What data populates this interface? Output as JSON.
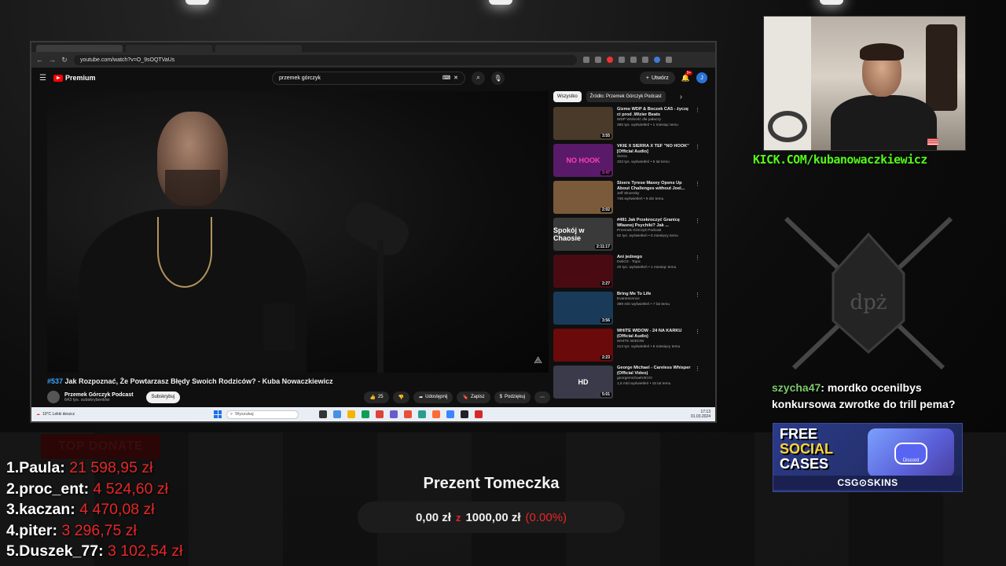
{
  "browser": {
    "url": "youtube.com/watch?v=O_9sOQTVaUs",
    "tabs": [
      "",
      "",
      ""
    ]
  },
  "youtube": {
    "logo_text": "Premium",
    "search_query": "przemek górczyk",
    "create_label": "Utwórz",
    "notif_count": "9+",
    "avatar_letter": "J",
    "video_title_hash": "#537",
    "video_title": "Jak Rozpoznać, Że Powtarzasz Błędy Swoich Rodziców? - Kuba Nowaczkiewicz",
    "channel_name": "Przemek Górczyk Podcast",
    "channel_subs": "643 tys. subskrybentów",
    "subscribe_label": "Subskrybuj",
    "like_count": "25",
    "share_label": "Udostępnij",
    "save_label": "Zapisz",
    "thanks_label": "Podziękuj",
    "chips": [
      "Wszystko",
      "Źródło: Przemek Górczyk Podcast"
    ],
    "recommendations": [
      {
        "title": "Gizmo WDP & Boczek CA5 - życzę ci      prod .Wizier Beats",
        "channel": "WDP Wolność dla pałaczy",
        "meta": "355 tys. wyświetleń • 1 miesiąc temu",
        "duration": "3:55",
        "thumb_color": "#4a3a2a"
      },
      {
        "title": "VKIE X SIERRA X TEF \"NO HOOK\" [Official Audio]",
        "channel": "Sierra",
        "meta": "333 tys. wyświetleń • 5 lat temu",
        "duration": "3:47",
        "thumb_color": "#5a1a6a",
        "thumb_text": "NO HOOK"
      },
      {
        "title": "Sixers Tyrese Maxey Opens Up About Challenges without Joel...",
        "channel": "Jeff Skversky",
        "meta": "746 wyświetleń • 9 dni temu",
        "duration": "2:02",
        "thumb_color": "#7a5a3a"
      },
      {
        "title": "#491 Jak Przekroczyć Granicę Własnej Psychiki? Jak ...",
        "channel": "Przemek Górczyk Podcast",
        "meta": "62 tys. wyświetleń • 5 miesięcy temu",
        "duration": "2:11:17",
        "thumb_color": "#3a3a3a",
        "thumb_text": "Spokój w Chaosie"
      },
      {
        "title": "Ani jednego",
        "channel": "DeliO3 - Topic",
        "meta": "20 tys. wyświetleń • 1 miesiąc temu",
        "duration": "2:27",
        "thumb_color": "#4a0a12"
      },
      {
        "title": "Bring Me To Life",
        "channel": "Evanescence",
        "meta": "389 mln wyświetleń • 7 lat temu",
        "duration": "3:56",
        "thumb_color": "#1a3a5a"
      },
      {
        "title": "WHITE WIDOW - 24 NA KARKU (Official Audio)",
        "channel": "WHITE WIDOW",
        "meta": "213 tys. wyświetleń • 8 miesięcy temu",
        "duration": "2:23",
        "thumb_color": "#6a0a0a"
      },
      {
        "title": "George Michael - Careless Whisper (Official Video)",
        "channel": "georgemichaelVEVO",
        "meta": "1,5 mld wyświetleń • 15 lat temu",
        "duration": "5:01",
        "thumb_color": "#3a3a4a",
        "thumb_text": "HD"
      }
    ]
  },
  "taskbar": {
    "weather": "10°C Lekki deszcz",
    "search_placeholder": "Wyszukaj",
    "time": "17:13",
    "date": "01.03.2024"
  },
  "overlay": {
    "kick_url": "KICK.COM/kubanowaczkiewicz",
    "chat_user": "szycha47",
    "chat_text": ": mordko ocenilbys konkursowa zwrotke do trill pema?",
    "promo_line1": "FREE",
    "promo_line2": "SOCIAL",
    "promo_line3": "CASES",
    "promo_brand": "CSG⊙SKINS",
    "promo_box_label": "Discord",
    "top_donate_title": "TOP DONATE",
    "donors": [
      {
        "rank": "1.",
        "name": "Paula:",
        "amount": "21 598,95 zł"
      },
      {
        "rank": "2.",
        "name": "proc_ent:",
        "amount": "4 524,60 zł"
      },
      {
        "rank": "3.",
        "name": "kaczan:",
        "amount": "4 470,08 zł"
      },
      {
        "rank": "4.",
        "name": "piter:",
        "amount": "3 296,75 zł"
      },
      {
        "rank": "5.",
        "name": "Duszek_77:",
        "amount": "3 102,54 zł"
      }
    ],
    "goal_title": "Prezent Tomeczka",
    "goal_current": "0,00 zł",
    "goal_sep": "z",
    "goal_target": "1000,00 zł",
    "goal_percent": "(0.00%)"
  }
}
